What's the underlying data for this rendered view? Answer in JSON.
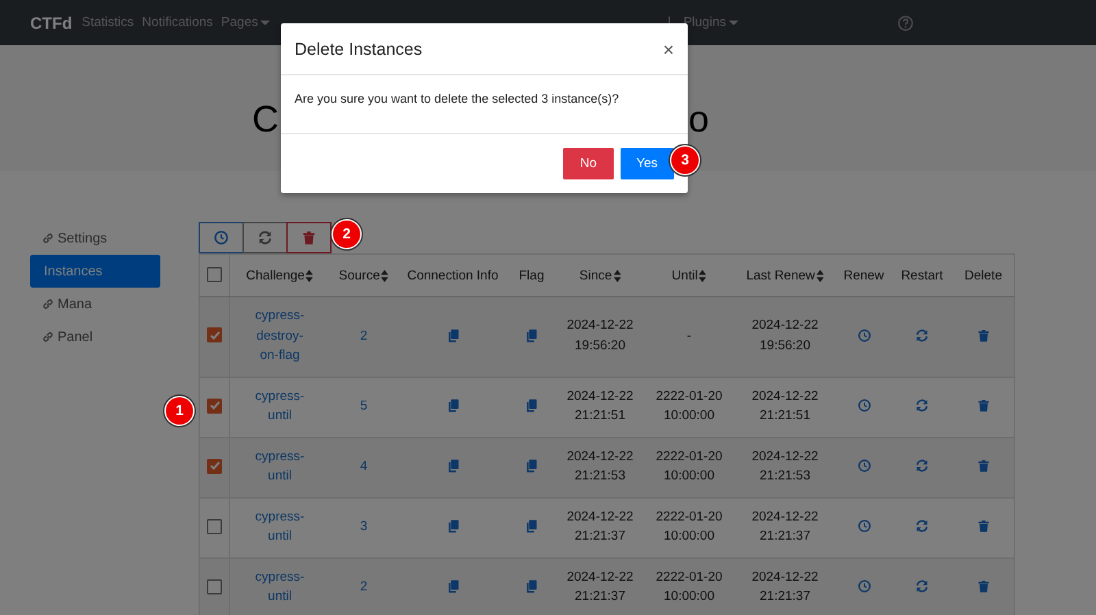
{
  "navbar": {
    "brand": "CTFd",
    "items": [
      {
        "label": "Statistics",
        "kind": "link"
      },
      {
        "label": "Notifications",
        "kind": "link"
      },
      {
        "label": "Pages",
        "kind": "dropdown"
      },
      {
        "label": "|",
        "kind": "separator"
      },
      {
        "label": "Plugins",
        "kind": "dropdown"
      }
    ]
  },
  "page_heading": {
    "visible_start": "C",
    "visible_end": "o"
  },
  "sidebar": {
    "items": [
      {
        "label": "Settings",
        "kind": "external",
        "selected": false
      },
      {
        "label": "Instances",
        "kind": "page",
        "selected": true
      },
      {
        "label": "Mana",
        "kind": "external",
        "selected": false
      },
      {
        "label": "Panel",
        "kind": "external",
        "selected": false
      }
    ]
  },
  "toolbar": {
    "buttons": [
      {
        "kind": "renew"
      },
      {
        "kind": "restart"
      },
      {
        "kind": "delete"
      }
    ]
  },
  "table": {
    "select_all_checked": false,
    "columns": [
      {
        "label": "Challenge",
        "sortable": true
      },
      {
        "label": "Source",
        "sortable": true
      },
      {
        "label": "Connection Info",
        "sortable": false
      },
      {
        "label": "Flag",
        "sortable": false
      },
      {
        "label": "Since",
        "sortable": true
      },
      {
        "label": "Until",
        "sortable": true
      },
      {
        "label": "Last Renew",
        "sortable": true
      },
      {
        "label": "Renew",
        "sortable": false
      },
      {
        "label": "Restart",
        "sortable": false
      },
      {
        "label": "Delete",
        "sortable": false
      }
    ],
    "rows": [
      {
        "selected": true,
        "challenge": "cypress-destroy-on-flag",
        "source": "2",
        "since": "2024-12-22 19:56:20",
        "until": "-",
        "last_renew": "2024-12-22 19:56:20"
      },
      {
        "selected": true,
        "challenge": "cypress-until",
        "source": "5",
        "since": "2024-12-22 21:21:51",
        "until": "2222-01-20 10:00:00",
        "last_renew": "2024-12-22 21:21:51"
      },
      {
        "selected": true,
        "challenge": "cypress-until",
        "source": "4",
        "since": "2024-12-22 21:21:53",
        "until": "2222-01-20 10:00:00",
        "last_renew": "2024-12-22 21:21:53"
      },
      {
        "selected": false,
        "challenge": "cypress-until",
        "source": "3",
        "since": "2024-12-22 21:21:37",
        "until": "2222-01-20 10:00:00",
        "last_renew": "2024-12-22 21:21:37"
      },
      {
        "selected": false,
        "challenge": "cypress-until",
        "source": "2",
        "since": "2024-12-22 21:21:37",
        "until": "2222-01-20 10:00:00",
        "last_renew": "2024-12-22 21:21:37"
      }
    ]
  },
  "modal": {
    "title": "Delete Instances",
    "close": "×",
    "body": "Are you sure you want to delete the selected 3 instance(s)?",
    "buttons": [
      {
        "label": "No",
        "kind": "danger"
      },
      {
        "label": "Yes",
        "kind": "primary"
      }
    ]
  },
  "markers": [
    {
      "label": "1"
    },
    {
      "label": "2"
    },
    {
      "label": "3"
    }
  ]
}
